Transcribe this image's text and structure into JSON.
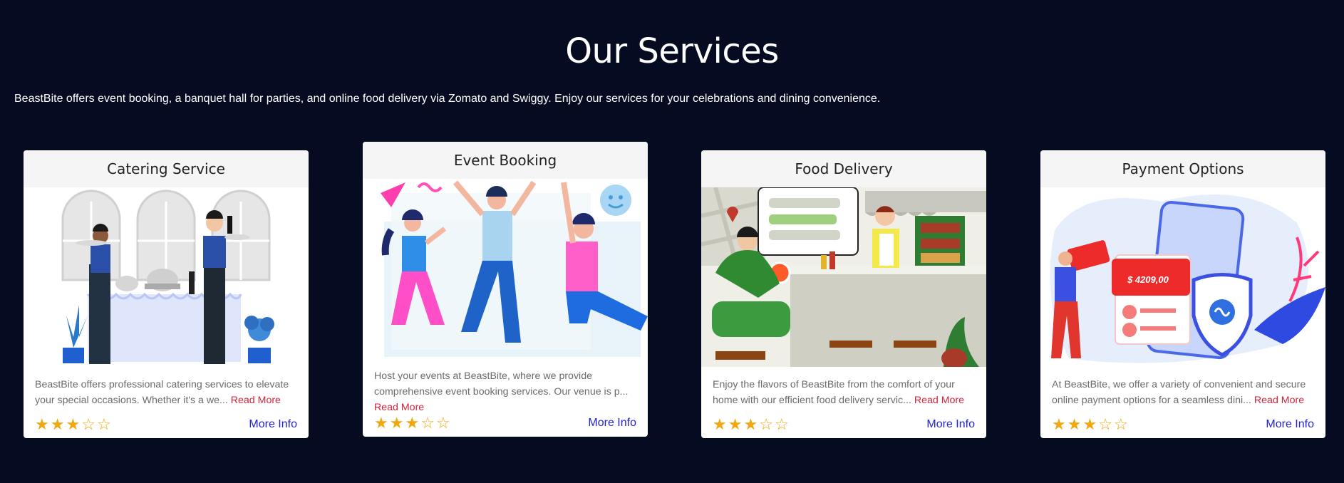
{
  "section": {
    "title": "Our Services",
    "subtitle": "BeastBite offers event booking, a banquet hall for parties, and online food delivery via Zomato and Swiggy. Enjoy our services for your celebrations and dining convenience."
  },
  "cards": [
    {
      "title": "Catering Service",
      "text": "BeastBite offers professional catering services to elevate your special occasions. Whether it's a we...",
      "read_more": "Read More",
      "rating": "3 of 5",
      "more_info": "More Info"
    },
    {
      "title": "Event Booking",
      "text": "Host your events at BeastBite, where we provide comprehensive event booking services. Our venue is p...",
      "read_more": "Read More",
      "rating": "3 of 5",
      "more_info": "More Info"
    },
    {
      "title": "Food Delivery",
      "text": "Enjoy the flavors of BeastBite from the comfort of your home with our efficient food delivery servic...",
      "read_more": "Read More",
      "rating": "3 of 5",
      "more_info": "More Info"
    },
    {
      "title": "Payment Options",
      "text": "At BeastBite, we offer a variety of convenient and secure online payment options for a seamless dini...",
      "read_more": "Read More",
      "rating": "3 of 5",
      "more_info": "More Info",
      "image_amount": "$ 4209,00"
    }
  ],
  "stars": {
    "filled": "★",
    "empty": "☆"
  },
  "colors": {
    "background": "#050c22",
    "star": "#f2a80c",
    "read_more": "#d1243a",
    "more_info": "#2323d6"
  }
}
